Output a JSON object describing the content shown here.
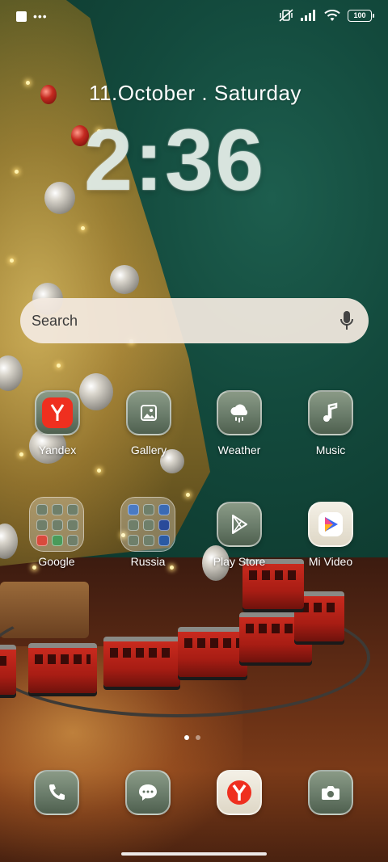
{
  "status_bar": {
    "battery": "100",
    "icons": [
      "notification-square-icon",
      "more-dots-icon",
      "vibrate-off-icon",
      "signal-icon",
      "wifi-icon",
      "battery-icon"
    ]
  },
  "clock": {
    "date": "11.October . Saturday",
    "time": "2:36"
  },
  "search": {
    "placeholder": "Search"
  },
  "apps_row1": [
    {
      "label": "Yandex",
      "icon": "yandex-icon"
    },
    {
      "label": "Gallery",
      "icon": "gallery-icon"
    },
    {
      "label": "Weather",
      "icon": "weather-icon"
    },
    {
      "label": "Music",
      "icon": "music-note-icon"
    }
  ],
  "apps_row2": [
    {
      "label": "Google",
      "icon": "folder-icon"
    },
    {
      "label": "Russia",
      "icon": "folder-icon"
    },
    {
      "label": "Play Store",
      "icon": "play-store-icon"
    },
    {
      "label": "Mi Video",
      "icon": "mi-video-icon"
    }
  ],
  "dock": [
    {
      "icon": "phone-icon"
    },
    {
      "icon": "messages-icon"
    },
    {
      "icon": "yandex-browser-icon"
    },
    {
      "icon": "camera-icon"
    }
  ],
  "pages": {
    "count": 2,
    "active": 1
  },
  "colors": {
    "accent_red": "#ef2f1f",
    "search_bg": "#f3eae0"
  }
}
